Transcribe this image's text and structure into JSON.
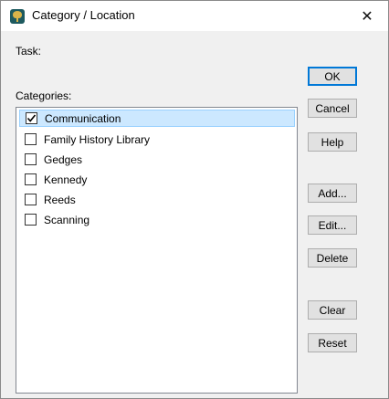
{
  "window": {
    "title": "Category / Location",
    "icon": "family-tree-app-icon",
    "close_glyph": "✕"
  },
  "task_label": "Task:",
  "categories_label": "Categories:",
  "categories": [
    {
      "label": "Communication",
      "checked": true,
      "selected": true
    },
    {
      "label": "Family History Library",
      "checked": false,
      "selected": false
    },
    {
      "label": "Gedges",
      "checked": false,
      "selected": false
    },
    {
      "label": "Kennedy",
      "checked": false,
      "selected": false
    },
    {
      "label": "Reeds",
      "checked": false,
      "selected": false
    },
    {
      "label": "Scanning",
      "checked": false,
      "selected": false
    }
  ],
  "buttons": {
    "ok": "OK",
    "cancel": "Cancel",
    "help": "Help",
    "add": "Add...",
    "edit": "Edit...",
    "delete": "Delete",
    "clear": "Clear",
    "reset": "Reset"
  },
  "colors": {
    "selection_bg": "#cce8ff",
    "selection_border": "#99d1ff",
    "default_button_border": "#0078d7"
  }
}
